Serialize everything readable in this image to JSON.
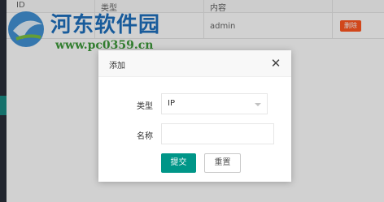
{
  "table": {
    "columns": [
      "ID",
      "类型",
      "内容"
    ],
    "row": {
      "content": "admin",
      "delete_label": "删除"
    }
  },
  "watermark": {
    "title": "河东软件园",
    "url": "www.pc0359.cn",
    "title_color": "#1e6fbe",
    "url_color": "#3e9a3a"
  },
  "dialog": {
    "title": "添加",
    "close_symbol": "✕",
    "fields": {
      "type_label": "类型",
      "type_value": "IP",
      "name_label": "名称",
      "name_value": "",
      "name_placeholder": ""
    },
    "buttons": {
      "submit": "提交",
      "reset": "重置"
    }
  },
  "colors": {
    "primary": "#009688",
    "danger": "#ff5722",
    "sidebar": "#2a2f3a"
  },
  "icons": {
    "logo": "hedong-logo-icon",
    "close": "close-icon",
    "dropdown": "chevron-down-icon"
  }
}
